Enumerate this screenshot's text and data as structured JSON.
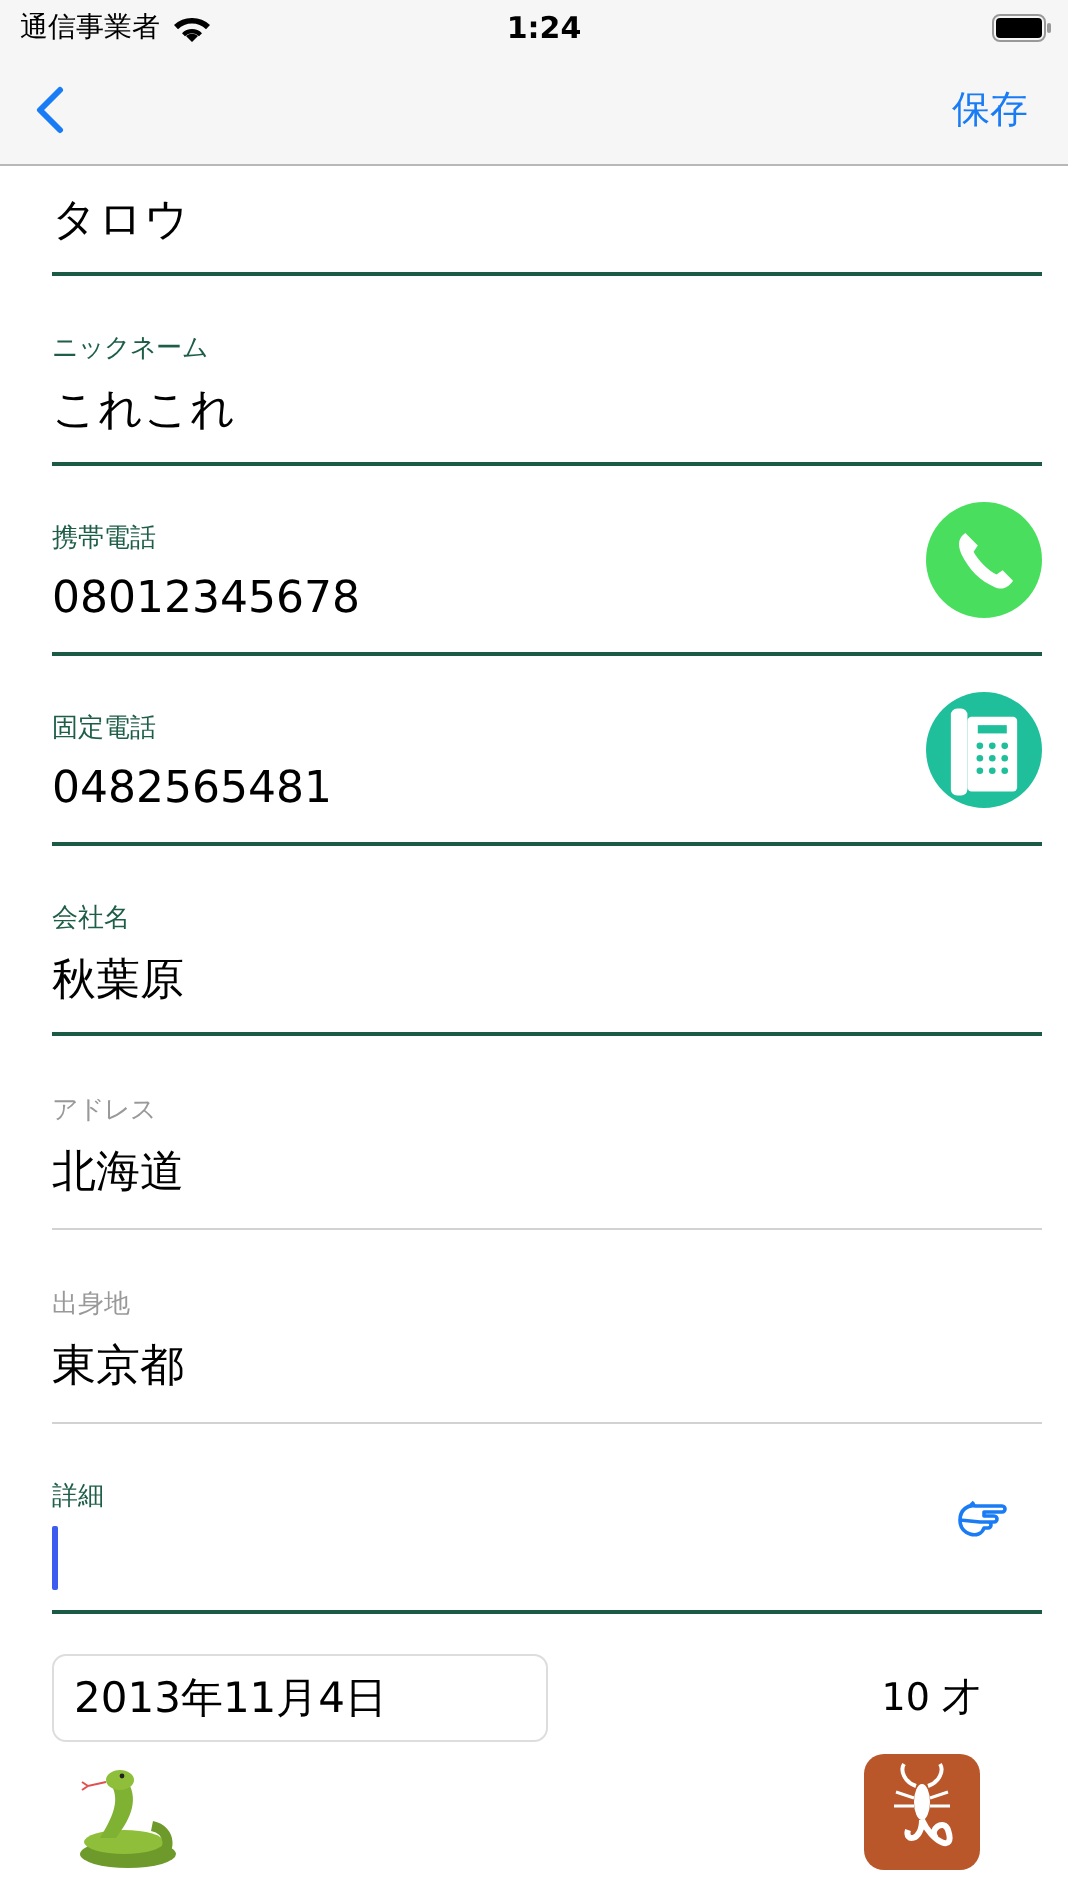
{
  "status_bar": {
    "carrier": "通信事業者",
    "time": "1:24"
  },
  "nav": {
    "action": "保存"
  },
  "fields": [
    {
      "value": "タロウ",
      "disabled": false
    },
    {
      "label": "ニックネーム",
      "value": "これこれ",
      "disabled": false
    },
    {
      "label": "携帯電話",
      "value": "08012345678",
      "disabled": false,
      "kind": "mobile"
    },
    {
      "label": "固定電話",
      "value": "0482565481",
      "disabled": false,
      "kind": "landline"
    },
    {
      "label": "会社名",
      "value": "秋葉原",
      "disabled": false
    },
    {
      "label": "アドレス",
      "value": "北海道",
      "disabled": true
    },
    {
      "label": "出身地",
      "value": "東京都",
      "disabled": true
    },
    {
      "label": "詳細",
      "disabled": false,
      "focused": true,
      "kind": "pointer"
    }
  ],
  "birthday": {
    "date": "2013年11月4日",
    "age": "10 才"
  }
}
